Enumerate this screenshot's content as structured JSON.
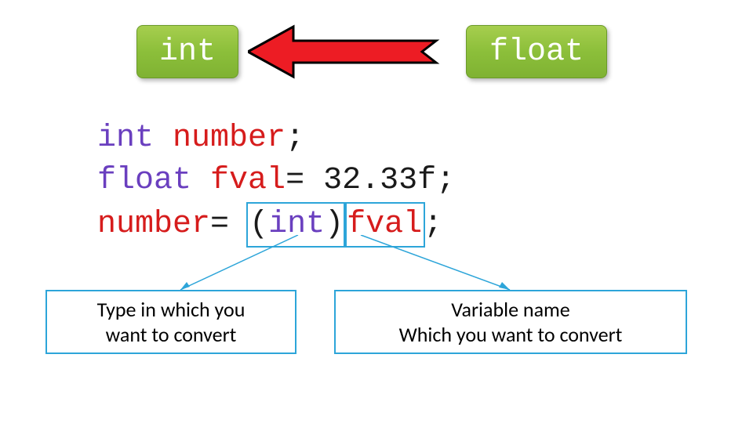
{
  "boxes": {
    "int_label": "int",
    "float_label": "float"
  },
  "code": {
    "line1_type": "int",
    "line1_var": "number",
    "line1_end": ";",
    "line2_type": "float",
    "line2_var": "fval",
    "line2_rest": "= 32.33f;",
    "line3_var": "number",
    "line3_eq": "= ",
    "line3_cast_open": "(",
    "line3_cast_type": "int",
    "line3_cast_close": ")",
    "line3_fval": "fval",
    "line3_end": ";"
  },
  "callouts": {
    "left_line1": "Type in which you",
    "left_line2": "want to convert",
    "right_line1": "Variable name",
    "right_line2": "Which you want to convert"
  },
  "colors": {
    "box_green": "#8cbf3a",
    "arrow_red": "#ed1c24",
    "keyword_purple": "#6a3fbf",
    "var_red": "#d61c1c",
    "callout_blue": "#2da5d9"
  }
}
